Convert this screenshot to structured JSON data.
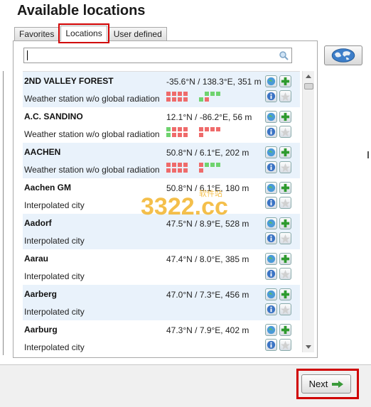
{
  "header": {
    "title": "Available locations"
  },
  "tabs": [
    {
      "label": "Favorites",
      "active": false
    },
    {
      "label": "Locations",
      "active": true
    },
    {
      "label": "User defined",
      "active": false
    }
  ],
  "search": {
    "value": "",
    "placeholder": ""
  },
  "colors": {
    "good": "#6fd36f",
    "missing": "#ef6b6b",
    "selection_outline": "#d00000",
    "alt_row": "#e9f2fb"
  },
  "locations": [
    {
      "name": "2ND VALLEY FOREST",
      "coords": "-35.6°N / 138.3°E, 351 m",
      "type": "Weather station w/o global radiation"
    },
    {
      "name": "A.C. SANDINO",
      "coords": "12.1°N / -86.2°E, 56 m",
      "type": "Weather station w/o global radiation"
    },
    {
      "name": "AACHEN",
      "coords": "50.8°N / 6.1°E, 202 m",
      "type": "Weather station w/o global radiation"
    },
    {
      "name": "Aachen GM",
      "coords": "50.8°N / 6.1°E, 180 m",
      "type": "Interpolated city"
    },
    {
      "name": "Aadorf",
      "coords": "47.5°N / 8.9°E, 528 m",
      "type": "Interpolated city"
    },
    {
      "name": "Aarau",
      "coords": "47.4°N / 8.0°E, 385 m",
      "type": "Interpolated city"
    },
    {
      "name": "Aarberg",
      "coords": "47.0°N / 7.3°E, 456 m",
      "type": "Interpolated city"
    },
    {
      "name": "Aarburg",
      "coords": "47.3°N / 7.9°E, 402 m",
      "type": "Interpolated city"
    }
  ],
  "footer": {
    "next_label": "Next"
  },
  "watermark": {
    "text": "3322.cc",
    "subtext": "软件站"
  }
}
